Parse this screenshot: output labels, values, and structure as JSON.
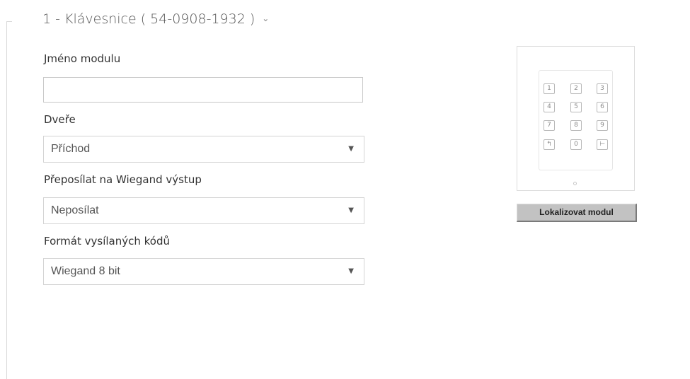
{
  "module": {
    "title": "1 - Klávesnice ( 54-0908-1932 )",
    "expand_icon": "chevron-down-icon"
  },
  "form": {
    "name": {
      "label": "Jméno modulu",
      "value": ""
    },
    "door": {
      "label": "Dveře",
      "value": "Příchod"
    },
    "wiegand_forward": {
      "label": "Přeposílat na Wiegand výstup",
      "value": "Neposílat"
    },
    "code_format": {
      "label": "Formát vysílaných kódů",
      "value": "Wiegand 8 bit"
    }
  },
  "keypad": {
    "keys": [
      "1",
      "2",
      "3",
      "4",
      "5",
      "6",
      "7",
      "8",
      "9",
      "↰",
      "0",
      "⊢"
    ]
  },
  "locate_button": {
    "label": "Lokalizovat modul"
  },
  "dropdown_icon": "triangle-down-icon"
}
